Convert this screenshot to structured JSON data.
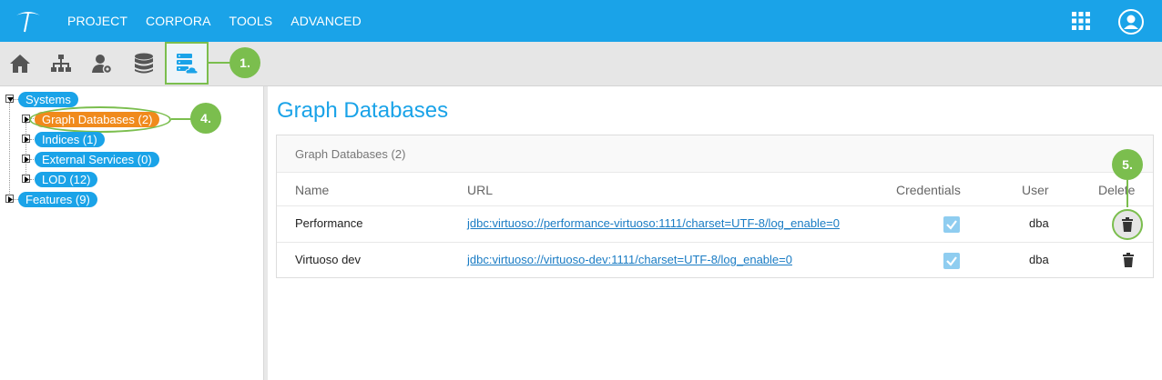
{
  "nav": {
    "menu": [
      "PROJECT",
      "CORPORA",
      "TOOLS",
      "ADVANCED"
    ]
  },
  "callouts": {
    "c1": "1.",
    "c4": "4.",
    "c5": "5."
  },
  "tree": {
    "systems": "Systems",
    "graph_databases": "Graph Databases (2)",
    "indices": "Indices (1)",
    "external_services": "External Services (0)",
    "lod": "LOD (12)",
    "features": "Features (9)"
  },
  "main": {
    "title": "Graph Databases",
    "panel_title": "Graph Databases (2)",
    "columns": {
      "name": "Name",
      "url": "URL",
      "credentials": "Credentials",
      "user": "User",
      "delete": "Delete"
    },
    "rows": [
      {
        "name": "Performance",
        "url": "jdbc:virtuoso://performance-virtuoso:1111/charset=UTF-8/log_enable=0",
        "credentials": true,
        "user": "dba"
      },
      {
        "name": "Virtuoso dev",
        "url": "jdbc:virtuoso://virtuoso-dev:1111/charset=UTF-8/log_enable=0",
        "credentials": true,
        "user": "dba"
      }
    ]
  },
  "colors": {
    "brand": "#1aa3e8",
    "selected": "#f08a1c",
    "callout": "#7bbe4e"
  }
}
